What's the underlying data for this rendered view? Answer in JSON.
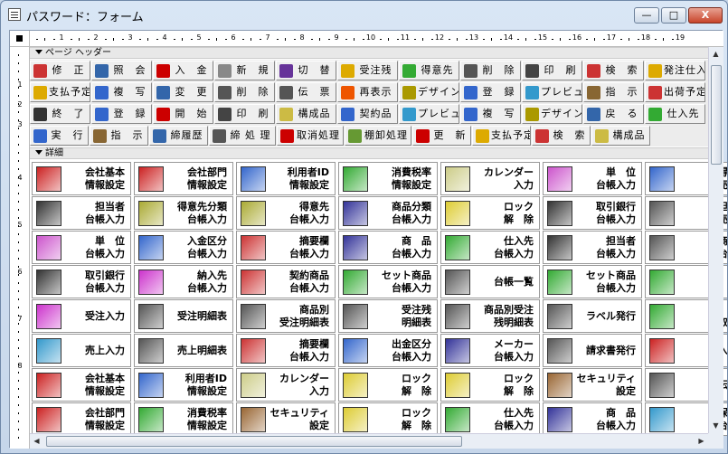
{
  "window": {
    "title": "パスワード：フォーム",
    "min": "—",
    "max": "□",
    "close": "X"
  },
  "ruler": {
    "h": [
      "1",
      "2",
      "3",
      "4",
      "5",
      "6",
      "7",
      "8",
      "9",
      "10",
      "11",
      "12",
      "13",
      "14",
      "15",
      "16",
      "17",
      "18",
      "19"
    ],
    "v": [
      "1",
      "2",
      "3",
      "4",
      "5",
      "6",
      "7",
      "8"
    ]
  },
  "sections": {
    "header": "ページ ヘッダー",
    "detail": "詳細"
  },
  "header_rows": [
    [
      {
        "t": "修　正",
        "c": "#c33"
      },
      {
        "t": "照　会",
        "c": "#36a"
      },
      {
        "t": "入　金",
        "c": "#c00"
      },
      {
        "t": "新　規",
        "c": "#888"
      },
      {
        "t": "切　替",
        "c": "#639"
      },
      {
        "t": "受注残",
        "c": "#da0"
      },
      {
        "t": "得意先",
        "c": "#3a3"
      },
      {
        "t": "削　除",
        "c": "#555"
      },
      {
        "t": "印　刷",
        "c": "#444"
      },
      {
        "t": "検　索",
        "c": "#c33"
      },
      {
        "t": "発注仕入",
        "c": "#da0"
      }
    ],
    [
      {
        "t": "支払予定",
        "c": "#da0"
      },
      {
        "t": "複　写",
        "c": "#36c"
      },
      {
        "t": "変　更",
        "c": "#36a"
      },
      {
        "t": "削　除",
        "c": "#555"
      },
      {
        "t": "伝　票",
        "c": "#555"
      },
      {
        "t": "再表示",
        "c": "#e50"
      },
      {
        "t": "デザイン",
        "c": "#a90"
      },
      {
        "t": "登　録",
        "c": "#36c"
      },
      {
        "t": "プレビュー",
        "c": "#39c"
      },
      {
        "t": "指　示",
        "c": "#863"
      },
      {
        "t": "出荷予定",
        "c": "#c33"
      }
    ],
    [
      {
        "t": "終　了",
        "c": "#333"
      },
      {
        "t": "登　録",
        "c": "#36c"
      },
      {
        "t": "開　始",
        "c": "#c00"
      },
      {
        "t": "印　刷",
        "c": "#444"
      },
      {
        "t": "構成品",
        "c": "#cb4"
      },
      {
        "t": "契約品",
        "c": "#36c"
      },
      {
        "t": "プレビュー",
        "c": "#39c"
      },
      {
        "t": "複　写",
        "c": "#36c"
      },
      {
        "t": "デザイン",
        "c": "#a90"
      },
      {
        "t": "戻　る",
        "c": "#36a"
      },
      {
        "t": "仕入先",
        "c": "#3a3"
      }
    ],
    [
      {
        "t": "実　行",
        "c": "#36c"
      },
      {
        "t": "指　示",
        "c": "#863"
      },
      {
        "t": "締履歴",
        "c": "#36a"
      },
      {
        "t": "締 処 理",
        "c": "#555"
      },
      {
        "t": "取消処理",
        "c": "#c00"
      },
      {
        "t": "棚卸処理",
        "c": "#693"
      },
      {
        "t": "更　新",
        "c": "#c00"
      },
      {
        "t": "支払予定",
        "c": "#da0"
      },
      {
        "t": "検　索",
        "c": "#c33"
      },
      {
        "t": "構成品",
        "c": "#cb4"
      }
    ]
  ],
  "detail_rows": [
    [
      {
        "l1": "会社基本",
        "l2": "情報設定",
        "c": "#c22"
      },
      {
        "l1": "会社部門",
        "l2": "情報設定",
        "c": "#c22"
      },
      {
        "l1": "利用者ID",
        "l2": "情報設定",
        "c": "#36c"
      },
      {
        "l1": "消費税率",
        "l2": "情報設定",
        "c": "#3a3"
      },
      {
        "l1": "カレンダー",
        "l2": "入力",
        "c": "#cc8"
      },
      {
        "l1": "単　位",
        "l2": "台帳入力",
        "c": "#c5c"
      },
      {
        "l1": "得意",
        "l2": "売上",
        "c": "#36c"
      }
    ],
    [
      {
        "l1": "担当者",
        "l2": "台帳入力",
        "c": "#333"
      },
      {
        "l1": "得意先分類",
        "l2": "台帳入力",
        "c": "#aa3"
      },
      {
        "l1": "得意先",
        "l2": "台帳入力",
        "c": "#aa3"
      },
      {
        "l1": "商品分類",
        "l2": "台帳入力",
        "c": "#339"
      },
      {
        "l1": "ロック",
        "l2": "解　除",
        "c": "#dc3"
      },
      {
        "l1": "取引銀行",
        "l2": "台帳入力",
        "c": "#333"
      },
      {
        "l1": "担当",
        "l2": "売上",
        "c": "#555"
      }
    ],
    [
      {
        "l1": "単　位",
        "l2": "台帳入力",
        "c": "#c5c"
      },
      {
        "l1": "入金区分",
        "l2": "台帳入力",
        "c": "#36c"
      },
      {
        "l1": "摘要欄",
        "l2": "台帳入力",
        "c": "#c33"
      },
      {
        "l1": "商　品",
        "l2": "台帳入力",
        "c": "#339"
      },
      {
        "l1": "仕入先",
        "l2": "台帳入力",
        "c": "#3a3"
      },
      {
        "l1": "担当者",
        "l2": "台帳入力",
        "c": "#333"
      },
      {
        "l1": "商品",
        "l2": "台帳",
        "c": "#555"
      }
    ],
    [
      {
        "l1": "取引銀行",
        "l2": "台帳入力",
        "c": "#333"
      },
      {
        "l1": "納入先",
        "l2": "台帳入力",
        "c": "#c3c"
      },
      {
        "l1": "契約商品",
        "l2": "台帳入力",
        "c": "#c33"
      },
      {
        "l1": "セット商品",
        "l2": "台帳入力",
        "c": "#3a3"
      },
      {
        "l1": "台帳一覧",
        "l2": "",
        "c": "#555"
      },
      {
        "l1": "セット商品",
        "l2": "台帳入力",
        "c": "#3a3"
      },
      {
        "l1": "請",
        "l2": "締",
        "c": "#3a3"
      }
    ],
    [
      {
        "l1": "受注入力",
        "l2": "",
        "c": "#c3c"
      },
      {
        "l1": "受注明細表",
        "l2": "",
        "c": "#555"
      },
      {
        "l1": "商品別",
        "l2": "受注明細表",
        "c": "#555"
      },
      {
        "l1": "受注残",
        "l2": "明細表",
        "c": "#555"
      },
      {
        "l1": "商品別受注",
        "l2": "残明細表",
        "c": "#555"
      },
      {
        "l1": "ラベル発行",
        "l2": "",
        "c": "#555"
      },
      {
        "l1": "請",
        "l2": "取消",
        "c": "#3a3"
      }
    ],
    [
      {
        "l1": "売上入力",
        "l2": "",
        "c": "#39c"
      },
      {
        "l1": "売上明細表",
        "l2": "",
        "c": "#555"
      },
      {
        "l1": "摘要欄",
        "l2": "台帳入力",
        "c": "#c33"
      },
      {
        "l1": "出金区分",
        "l2": "台帳入力",
        "c": "#36c"
      },
      {
        "l1": "メーカー",
        "l2": "台帳入力",
        "c": "#339"
      },
      {
        "l1": "請求書発行",
        "l2": "",
        "c": "#555"
      },
      {
        "l1": "入金",
        "l2": "",
        "c": "#c22"
      }
    ],
    [
      {
        "l1": "会社基本",
        "l2": "情報設定",
        "c": "#c22"
      },
      {
        "l1": "利用者ID",
        "l2": "情報設定",
        "c": "#36c"
      },
      {
        "l1": "カレンダー",
        "l2": "入力",
        "c": "#cc8"
      },
      {
        "l1": "ロック",
        "l2": "解　除",
        "c": "#dc3"
      },
      {
        "l1": "ロック",
        "l2": "解　除",
        "c": "#dc3"
      },
      {
        "l1": "セキュリティ",
        "l2": "設定",
        "c": "#963"
      },
      {
        "l1": "伝票",
        "l2": "",
        "c": "#555"
      }
    ],
    [
      {
        "l1": "会社部門",
        "l2": "情報設定",
        "c": "#c22"
      },
      {
        "l1": "消費税率",
        "l2": "情報設定",
        "c": "#3a3"
      },
      {
        "l1": "セキュリティ",
        "l2": "設定",
        "c": "#963"
      },
      {
        "l1": "ロック",
        "l2": "解　除",
        "c": "#dc3"
      },
      {
        "l1": "仕入先",
        "l2": "台帳入力",
        "c": "#3a3"
      },
      {
        "l1": "商　品",
        "l2": "台帳入力",
        "c": "#339"
      },
      {
        "l1": "保管",
        "l2": "台帳",
        "c": "#39c"
      }
    ]
  ]
}
